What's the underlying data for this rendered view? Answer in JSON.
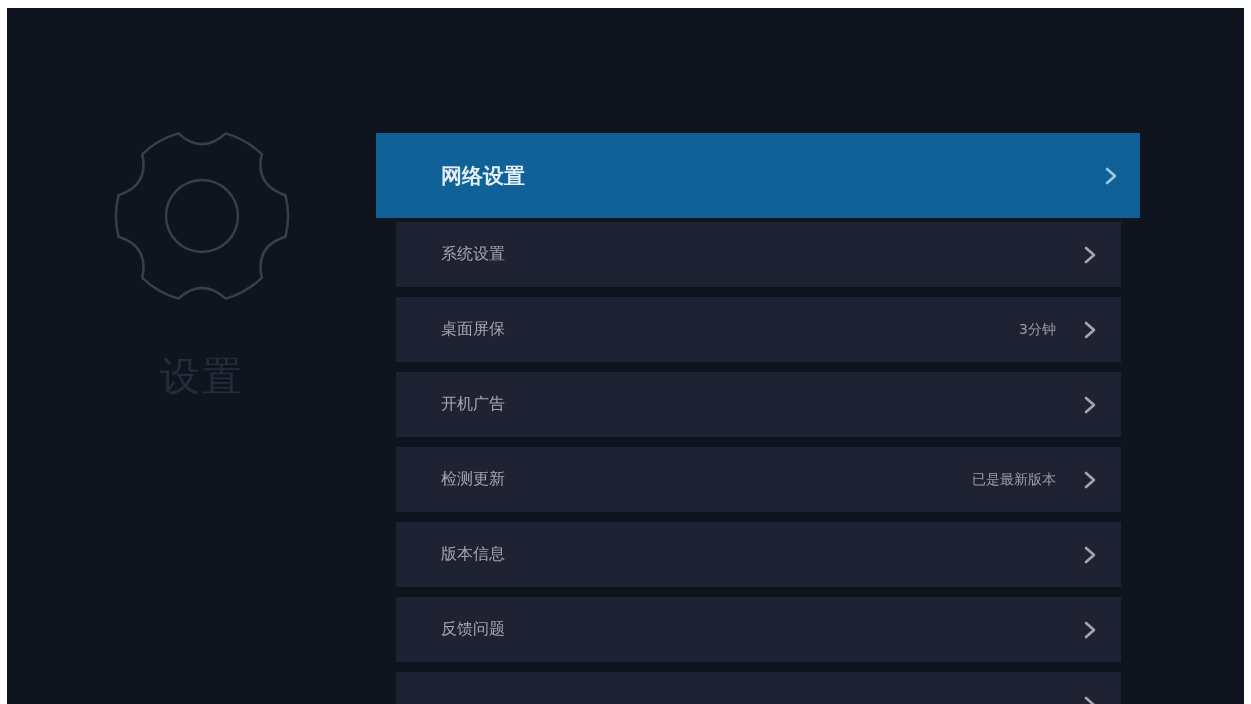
{
  "sidebar": {
    "title": "设置"
  },
  "menu": {
    "items": [
      {
        "label": "网络设置",
        "selected": true
      },
      {
        "label": "系统设置",
        "selected": false
      },
      {
        "label": "桌面屏保",
        "value": "3分钟",
        "selected": false
      },
      {
        "label": "开机广告",
        "selected": false
      },
      {
        "label": "检测更新",
        "value": "已是最新版本",
        "selected": false
      },
      {
        "label": "版本信息",
        "selected": false
      },
      {
        "label": "反馈问题",
        "selected": false
      },
      {
        "selected": false
      }
    ]
  }
}
